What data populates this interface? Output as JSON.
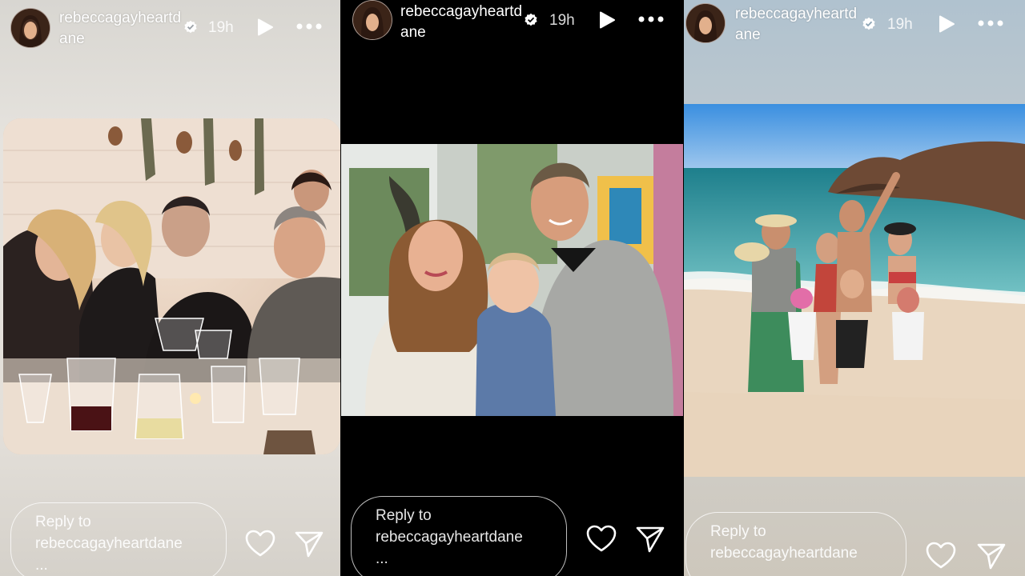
{
  "stories": [
    {
      "username": "rebeccagayheartdane",
      "time": "19h",
      "reply_prefix": "Reply to",
      "reply_user": "rebeccagayheartdane",
      "reply_more": "..."
    },
    {
      "username": "rebeccagayheartdane",
      "time": "19h",
      "reply_prefix": "Reply to",
      "reply_user": "rebeccagayheartdane",
      "reply_more": "..."
    },
    {
      "username": "rebeccagayheartdane",
      "time": "19h",
      "reply_prefix": "Reply to",
      "reply_user": "rebeccagayheartdane",
      "reply_more": ""
    }
  ],
  "icons": {
    "verified": "verified-badge-icon",
    "play": "play-icon",
    "more": "more-options-icon",
    "like": "heart-icon",
    "share": "send-icon"
  },
  "colors": {
    "text_on_story": "#ffffff",
    "panel_2_background": "#000000"
  }
}
